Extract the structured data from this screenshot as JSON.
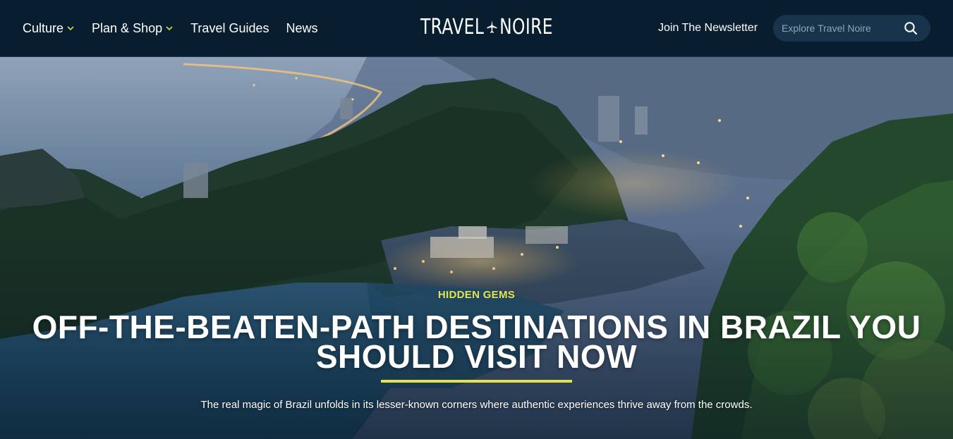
{
  "header": {
    "nav": [
      {
        "label": "Culture",
        "has_dropdown": true
      },
      {
        "label": "Plan & Shop",
        "has_dropdown": true
      },
      {
        "label": "Travel Guides",
        "has_dropdown": false
      },
      {
        "label": "News",
        "has_dropdown": false
      }
    ],
    "logo": {
      "left": "TRAVEL",
      "right": "NOIRE",
      "icon": "airplane-icon"
    },
    "newsletter_label": "Join The Newsletter",
    "search": {
      "placeholder": "Explore Travel Noire",
      "icon": "search-icon"
    }
  },
  "hero": {
    "category": "HIDDEN GEMS",
    "title_line1": "OFF-THE-BEATEN-PATH DESTINATIONS IN BRAZIL YOU",
    "title_line2": "SHOULD VISIT NOW",
    "subtitle": "The real magic of Brazil unfolds in its lesser-known corners where authentic experiences thrive away from the crowds."
  },
  "colors": {
    "header_bg": "#081e2f",
    "accent": "#e6e24a",
    "chevron": "#c8e04a",
    "search_bg": "#18344c"
  }
}
